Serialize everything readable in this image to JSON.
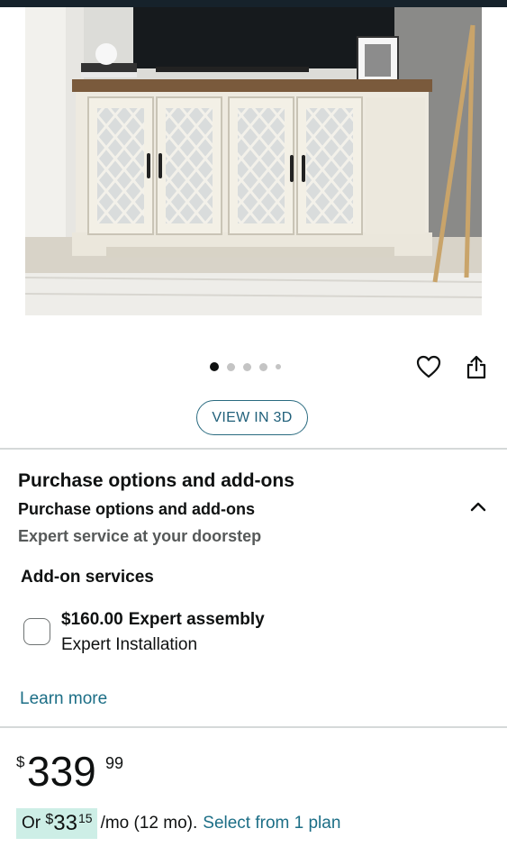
{
  "gallery": {
    "image_alt": "White TV stand console with four mirrored lattice doors",
    "dot_count": 5,
    "active_dot": 0,
    "view_3d_label": "VIEW IN 3D"
  },
  "icons": {
    "wishlist": "heart-icon",
    "share": "share-icon",
    "collapse": "chevron-up-icon"
  },
  "purchase_options": {
    "title": "Purchase options and add-ons",
    "subtitle": "Purchase options and add-ons",
    "description": "Expert service at your doorstep",
    "addon_heading": "Add-on services",
    "addon": {
      "price": "$160.00",
      "name": "Expert assembly",
      "detail": "Expert Installation",
      "checked": false
    },
    "learn_more": "Learn more"
  },
  "price": {
    "currency": "$",
    "whole": "339",
    "fraction": "99"
  },
  "monthly": {
    "prefix": "Or",
    "currency": "$",
    "whole": "33",
    "fraction": "15",
    "suffix": "/mo (12 mo).",
    "link": "Select from 1 plan"
  },
  "colors": {
    "link": "#1c6e86",
    "highlight": "#cdeee6",
    "divider": "#d5d9d9"
  }
}
